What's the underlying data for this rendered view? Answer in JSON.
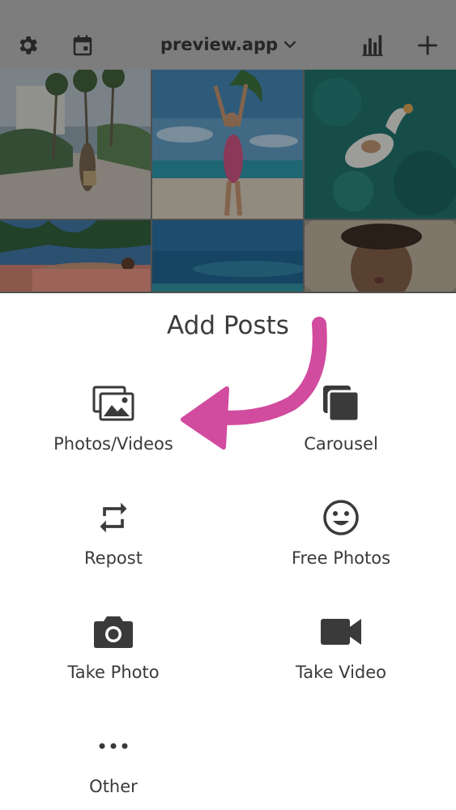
{
  "header": {
    "title": "preview.app",
    "icons": {
      "settings": "gear-icon",
      "calendar": "calendar-icon",
      "dropdown": "chevron-down-icon",
      "stats": "bar-chart-icon",
      "add": "plus-icon"
    }
  },
  "grid": {
    "tiles": [
      {
        "icon": "photo-palm-street"
      },
      {
        "icon": "photo-beach-swimsuit"
      },
      {
        "icon": "photo-pool-float"
      },
      {
        "icon": "photo-lounging"
      },
      {
        "icon": "photo-ocean"
      },
      {
        "icon": "photo-sunhat-portrait"
      }
    ]
  },
  "sheet": {
    "title": "Add Posts",
    "options": [
      {
        "label": "Photos/Videos",
        "icon": "photos-icon"
      },
      {
        "label": "Carousel",
        "icon": "carousel-icon"
      },
      {
        "label": "Repost",
        "icon": "repost-icon"
      },
      {
        "label": "Free Photos",
        "icon": "smiley-icon"
      },
      {
        "label": "Take Photo",
        "icon": "camera-icon"
      },
      {
        "label": "Take Video",
        "icon": "video-camera-icon"
      },
      {
        "label": "Other",
        "icon": "more-icon"
      }
    ]
  },
  "colors": {
    "accent_arrow": "#d14b9e",
    "icon": "#3a3a3a",
    "topbar_dim": "#7d7d7d"
  }
}
